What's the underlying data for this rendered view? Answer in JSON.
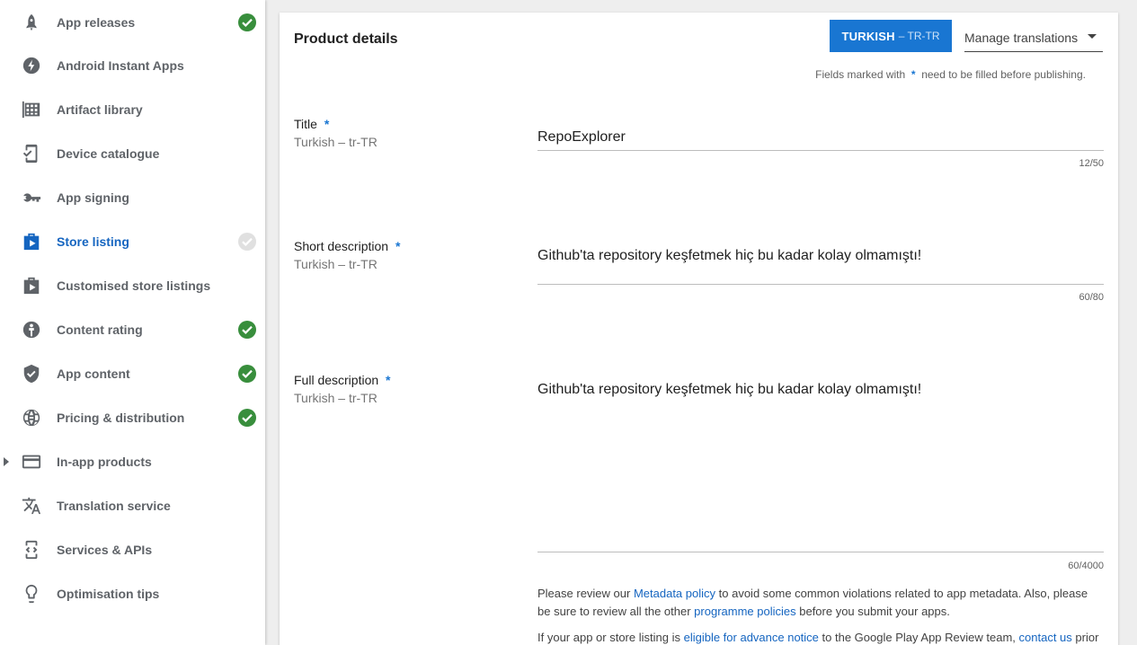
{
  "sidebar": {
    "items": [
      {
        "label": "App releases",
        "icon": "rocket-icon",
        "status": "complete"
      },
      {
        "label": "Android Instant Apps",
        "icon": "bolt-icon",
        "status": ""
      },
      {
        "label": "Artifact library",
        "icon": "grid-icon",
        "status": ""
      },
      {
        "label": "Device catalogue",
        "icon": "device-check-icon",
        "status": ""
      },
      {
        "label": "App signing",
        "icon": "key-icon",
        "status": ""
      },
      {
        "label": "Store listing",
        "icon": "play-store-icon",
        "status": "pending",
        "active": true
      },
      {
        "label": "Customised store listings",
        "icon": "play-store-icon",
        "status": ""
      },
      {
        "label": "Content rating",
        "icon": "rating-icon",
        "status": "complete"
      },
      {
        "label": "App content",
        "icon": "shield-check-icon",
        "status": "complete"
      },
      {
        "label": "Pricing & distribution",
        "icon": "globe-icon",
        "status": "complete"
      },
      {
        "label": "In-app products",
        "icon": "card-icon",
        "status": ""
      },
      {
        "label": "Translation service",
        "icon": "translate-icon",
        "status": ""
      },
      {
        "label": "Services & APIs",
        "icon": "api-icon",
        "status": ""
      },
      {
        "label": "Optimisation tips",
        "icon": "lightbulb-icon",
        "status": ""
      }
    ]
  },
  "main": {
    "section_title": "Product details",
    "language_button": {
      "name": "TURKISH",
      "code": "– TR-TR"
    },
    "manage_translations": "Manage translations",
    "required_note": {
      "before": "Fields marked with",
      "star": "*",
      "after": "need to be filled before publishing."
    },
    "fields": {
      "title": {
        "label": "Title",
        "star": "*",
        "sub": "Turkish – tr-TR",
        "value": "RepoExplorer",
        "counter": "12/50"
      },
      "short_description": {
        "label": "Short description",
        "star": "*",
        "sub": "Turkish – tr-TR",
        "value": "Github'ta repository keşfetmek hiç bu kadar kolay olmamıştı!",
        "counter": "60/80"
      },
      "full_description": {
        "label": "Full description",
        "star": "*",
        "sub": "Turkish – tr-TR",
        "value": "Github'ta repository keşfetmek hiç bu kadar kolay olmamıştı!",
        "counter": "60/4000"
      }
    },
    "policy": {
      "p1_a": "Please review our",
      "p1_link": "Metadata policy",
      "p1_b": "to avoid some common violations related to app metadata. Also, please be sure to review all the other",
      "p1_link2": "programme policies",
      "p1_c": "before you submit your apps.",
      "p2_a": "If your app or store listing is",
      "p2_link": "eligible for advance notice",
      "p2_b": "to the Google Play App Review team,",
      "p2_link2": "contact us",
      "p2_c": "prior"
    }
  },
  "colors": {
    "accent": "#1976d2",
    "complete": "#388e3c",
    "pending": "#e0e0e0",
    "active_text": "#1565c0"
  }
}
